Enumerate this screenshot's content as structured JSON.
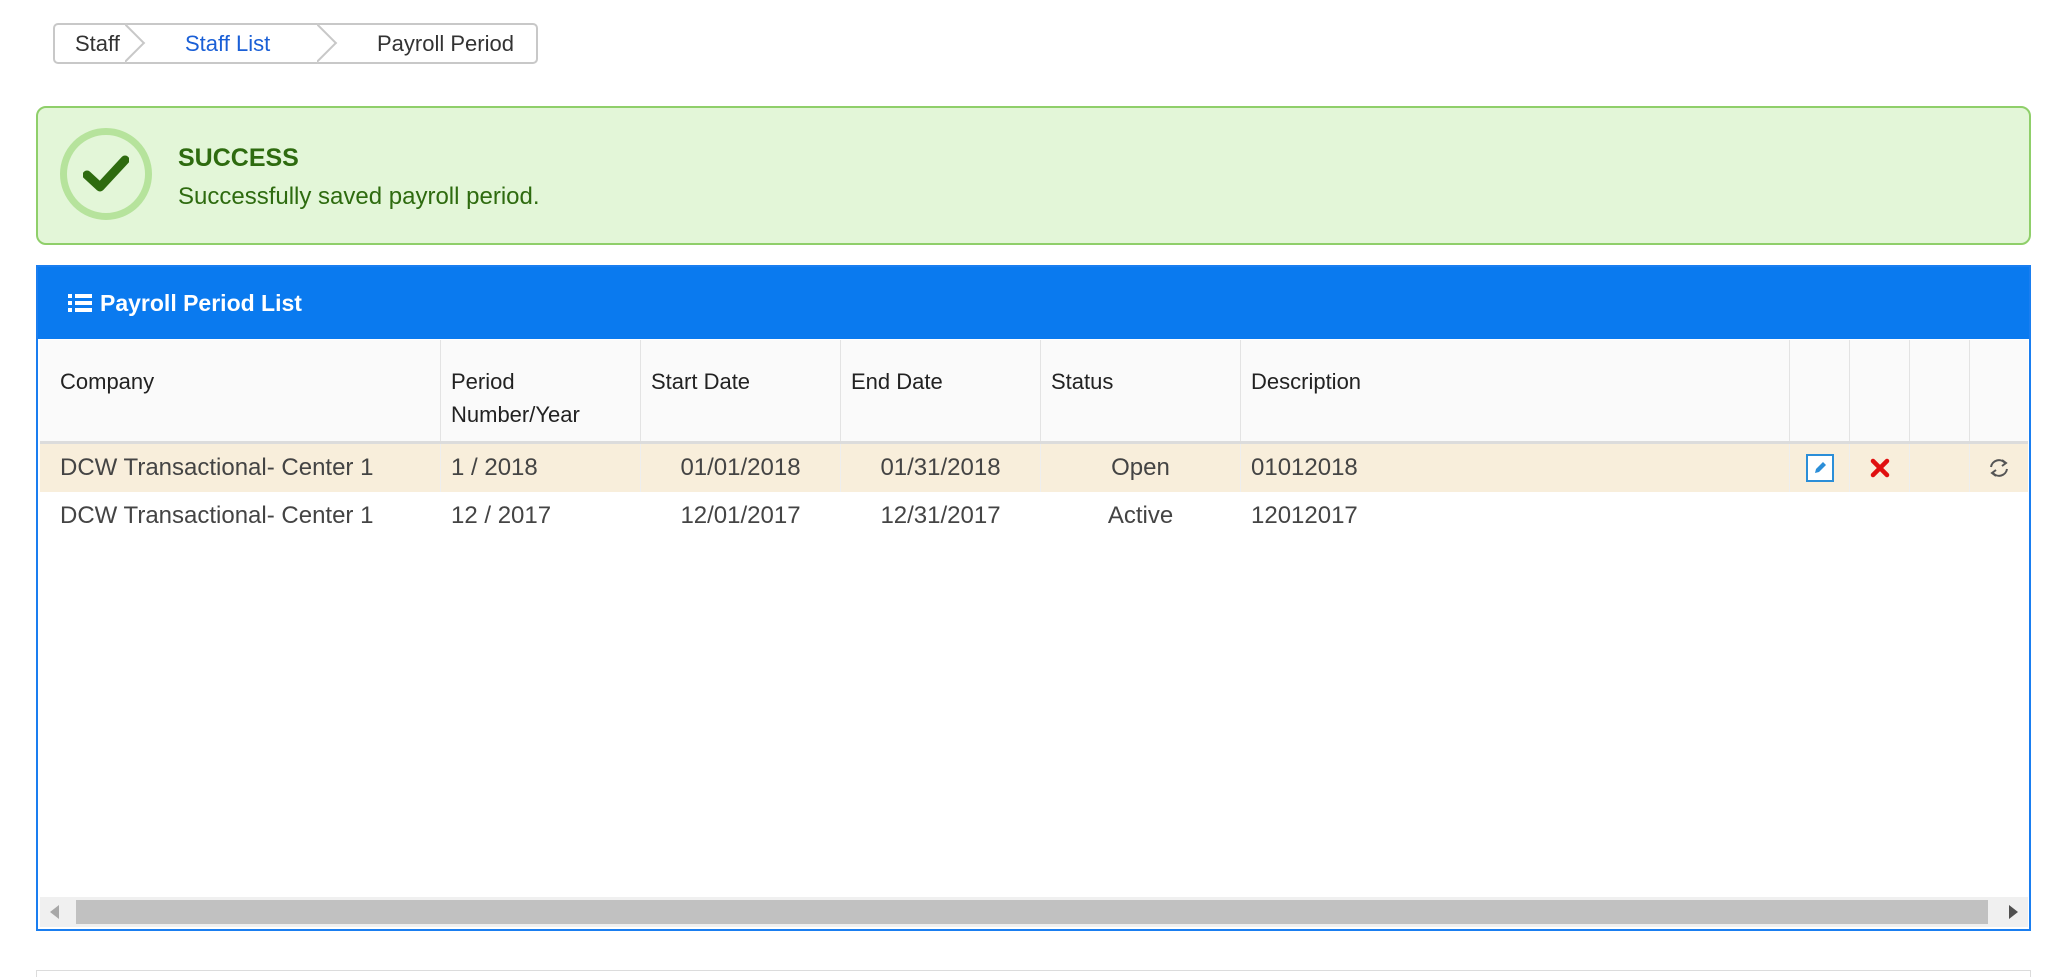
{
  "breadcrumb": {
    "items": [
      "Staff",
      "Staff List",
      "Payroll Period"
    ]
  },
  "alert": {
    "title": "SUCCESS",
    "message": "Successfully saved payroll period.",
    "icon": "check-icon",
    "color": "#2e6b0f"
  },
  "panel": {
    "title": "Payroll Period List",
    "icon": "list-icon",
    "header_color": "#0a7aef"
  },
  "table": {
    "columns": {
      "company": "Company",
      "period_line1": "Period",
      "period_line2": "Number/Year",
      "start": "Start Date",
      "end": "End Date",
      "status": "Status",
      "description": "Description"
    },
    "rows": [
      {
        "company": "DCW Transactional- Center 1",
        "period": "1 / 2018",
        "start": "01/01/2018",
        "end": "01/31/2018",
        "status": "Open",
        "description": "01012018",
        "actions": [
          "edit-icon",
          "delete-icon",
          "refresh-icon"
        ]
      },
      {
        "company": "DCW Transactional- Center 1",
        "period": "12 / 2017",
        "start": "12/01/2017",
        "end": "12/31/2017",
        "status": "Active",
        "description": "12012017"
      }
    ]
  }
}
